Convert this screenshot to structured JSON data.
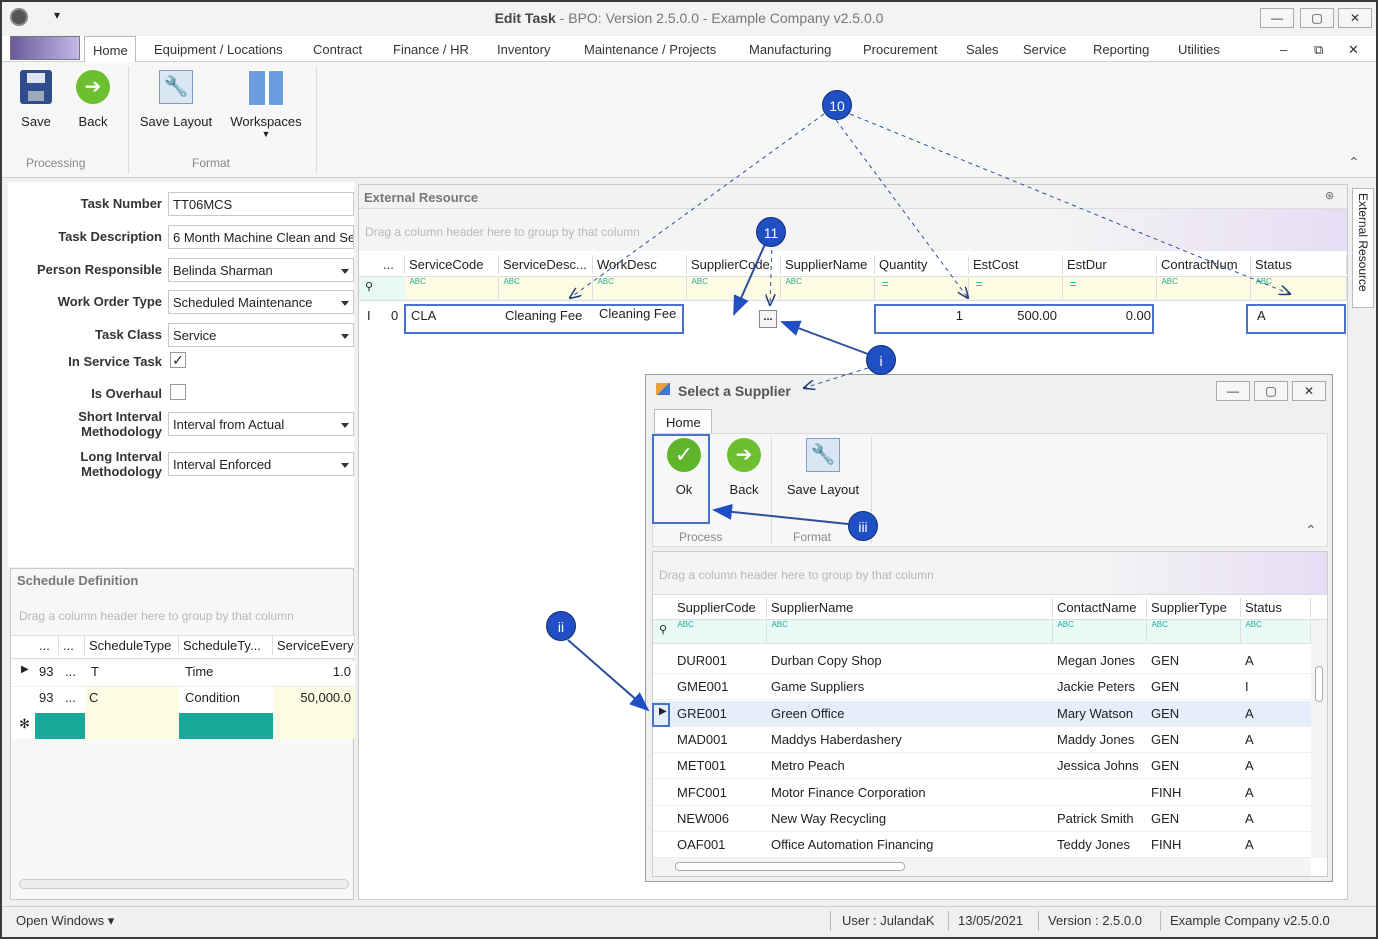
{
  "window": {
    "title": "Edit Task",
    "subtitle": " - BPO: Version 2.5.0.0 - Example Company v2.5.0.0",
    "min": "—",
    "max": "▢",
    "close": "✕"
  },
  "menu": {
    "items": [
      "Home",
      "Equipment / Locations",
      "Contract",
      "Finance / HR",
      "Inventory",
      "Maintenance / Projects",
      "Manufacturing",
      "Procurement",
      "Sales",
      "Service",
      "Reporting",
      "Utilities"
    ],
    "app_min": "–",
    "app_restore": "⧉",
    "app_close": "✕"
  },
  "ribbon": {
    "save": "Save",
    "back": "Back",
    "save_layout": "Save Layout",
    "workspaces": "Workspaces",
    "group_processing": "Processing",
    "group_format": "Format"
  },
  "form": {
    "task_number_label": "Task Number",
    "task_number": "TT06MCS",
    "task_desc_label": "Task Description",
    "task_desc": "6 Month Machine Clean and Se",
    "person_label": "Person Responsible",
    "person": "Belinda Sharman",
    "wo_type_label": "Work Order Type",
    "wo_type": "Scheduled Maintenance",
    "task_class_label": "Task Class",
    "task_class": "Service",
    "in_service_label": "In Service Task",
    "in_service": "✓",
    "overhaul_label": "Is Overhaul",
    "short_label_1": "Short Interval",
    "short_label_2": "Methodology",
    "short": "Interval from Actual",
    "long_label_1": "Long Interval",
    "long_label_2": "Methodology",
    "long": "Interval Enforced"
  },
  "schedule": {
    "title": "Schedule Definition",
    "hint": "Drag a column header here to group by that column",
    "headers": [
      "...",
      "...",
      "ScheduleType",
      "ScheduleTy...",
      "ServiceEvery"
    ],
    "rows": [
      {
        "a": "93",
        "b": "...",
        "c": "T",
        "d": "Time",
        "e": "1.0"
      },
      {
        "a": "93",
        "b": "...",
        "c": "C",
        "d": "Condition",
        "e": "50,000.0"
      }
    ],
    "new_row": "✻"
  },
  "ext": {
    "title": "External Resource",
    "side_tab": "External Resource",
    "hint": "Drag a column header here to group by that column",
    "headers": [
      "...",
      "ServiceCode",
      "ServiceDesc...",
      "WorkDesc",
      "SupplierCode",
      "SupplierName",
      "Quantity",
      "EstCost",
      "EstDur",
      "ContractNum",
      "Status"
    ],
    "row": {
      "marker": "I",
      "idx": "0",
      "code": "CLA",
      "desc": "Cleaning Fee",
      "work": "Cleaning Fee",
      "ellipsis": "...",
      "qty": "1",
      "cost": "500.00",
      "dur": "0.00",
      "status": "A"
    }
  },
  "callouts": {
    "c10": "10",
    "c11": "11",
    "ci": "i",
    "cii": "ii",
    "ciii": "iii"
  },
  "dialog": {
    "title": "Select a Supplier",
    "tab": "Home",
    "ok": "Ok",
    "back": "Back",
    "save_layout": "Save Layout",
    "group_process": "Process",
    "group_format": "Format",
    "hint": "Drag a column header here to group by that column",
    "headers": [
      "SupplierCode",
      "SupplierName",
      "ContactName",
      "SupplierType",
      "Status"
    ],
    "rows": [
      {
        "code": "DUR001",
        "name": "Durban Copy Shop",
        "contact": "Megan Jones",
        "type": "GEN",
        "status": "A"
      },
      {
        "code": "GME001",
        "name": "Game Suppliers",
        "contact": "Jackie Peters",
        "type": "GEN",
        "status": "I"
      },
      {
        "code": "GRE001",
        "name": "Green Office",
        "contact": "Mary Watson",
        "type": "GEN",
        "status": "A"
      },
      {
        "code": "MAD001",
        "name": "Maddys Haberdashery",
        "contact": "Maddy Jones",
        "type": "GEN",
        "status": "A"
      },
      {
        "code": "MET001",
        "name": "Metro Peach",
        "contact": "Jessica Johns",
        "type": "GEN",
        "status": "A"
      },
      {
        "code": "MFC001",
        "name": "Motor Finance Corporation",
        "contact": "",
        "type": "FINH",
        "status": "A"
      },
      {
        "code": "NEW006",
        "name": "New Way Recycling",
        "contact": "Patrick Smith",
        "type": "GEN",
        "status": "A"
      },
      {
        "code": "OAF001",
        "name": "Office Automation Financing",
        "contact": "Teddy Jones",
        "type": "FINH",
        "status": "A"
      }
    ]
  },
  "status": {
    "open_windows": "Open Windows ▾",
    "user": "User : JulandaK",
    "date": "13/05/2021",
    "version": "Version : 2.5.0.0",
    "company": "Example Company v2.5.0.0"
  },
  "colors": {
    "accent": "#4a73c8",
    "callout": "#1f4fc2",
    "filter_bg": "#fdfbe3",
    "teal": "#1aa89a"
  }
}
